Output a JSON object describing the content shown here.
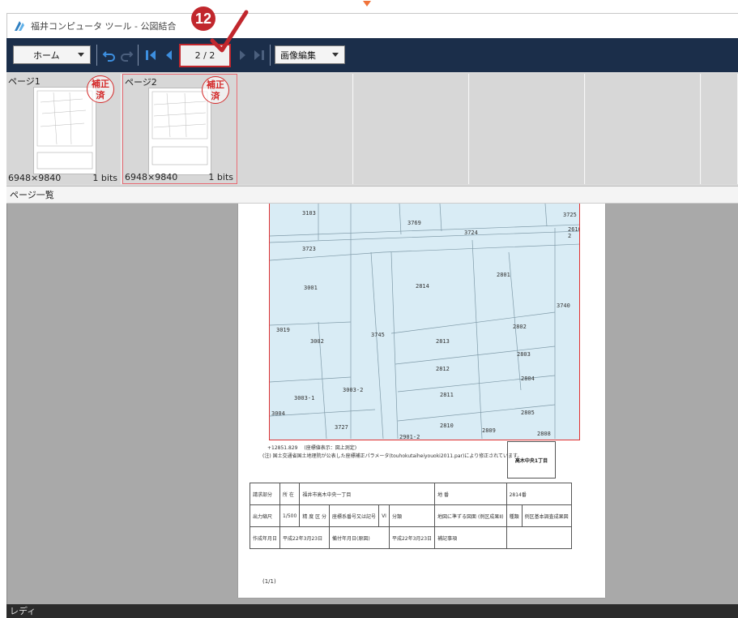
{
  "window": {
    "title": "福井コンピュータ ツール - 公図結合"
  },
  "toolbar": {
    "home_label": "ホーム",
    "page_indicator": "2 / 2",
    "image_edit_label": "画像編集"
  },
  "callout": {
    "number": "12"
  },
  "thumbnails": [
    {
      "label": "ページ1",
      "stamp_line1": "補正",
      "stamp_line2": "済",
      "size": "6948×9840",
      "bits": "1 bits"
    },
    {
      "label": "ページ2",
      "stamp_line1": "補正",
      "stamp_line2": "済",
      "size": "6948×9840",
      "bits": "1 bits"
    }
  ],
  "page_list": {
    "label": "ページ一覧"
  },
  "document": {
    "lots": [
      "3103",
      "3769",
      "3724",
      "3725",
      "2610-2",
      "3723",
      "3001",
      "2814",
      "2801",
      "3740",
      "3019",
      "3002",
      "3745",
      "2813",
      "2802",
      "2803",
      "2812",
      "2804",
      "3003-1",
      "3003-2",
      "2811",
      "3004",
      "2805",
      "3727",
      "2810",
      "2809",
      "2808",
      "2901-2"
    ],
    "note": "(注) 国土交通省国土地理院が公表した座標補正パラメータ(touhokutaiheiyouoki2011.par)により修正されています。",
    "stamp_text": "高木中央1丁目",
    "info": {
      "row1": [
        "請求部分",
        "所 在",
        "福井市高木中央一丁目",
        "地 番",
        "2814番"
      ],
      "row2": [
        "出力縮尺",
        "1/500",
        "精 度 区 分",
        "座標系番号又は記号",
        "VI",
        "分類",
        "地図に準ずる図面 (例区成果Ⅱ)",
        "種類",
        "例区基本調査成果図"
      ],
      "row3": [
        "作成年月日",
        "平成22年3月23日",
        "備付年月日(原図)",
        "平成22年3月23日",
        "補記事項"
      ]
    },
    "page_number": "(1/1)"
  },
  "status": {
    "text": "レディ"
  },
  "colors": {
    "toolbar_bg": "#1b2e4a",
    "highlight": "#c1272d",
    "map_bg": "#d9ecf5",
    "boundary": "#e03030"
  }
}
